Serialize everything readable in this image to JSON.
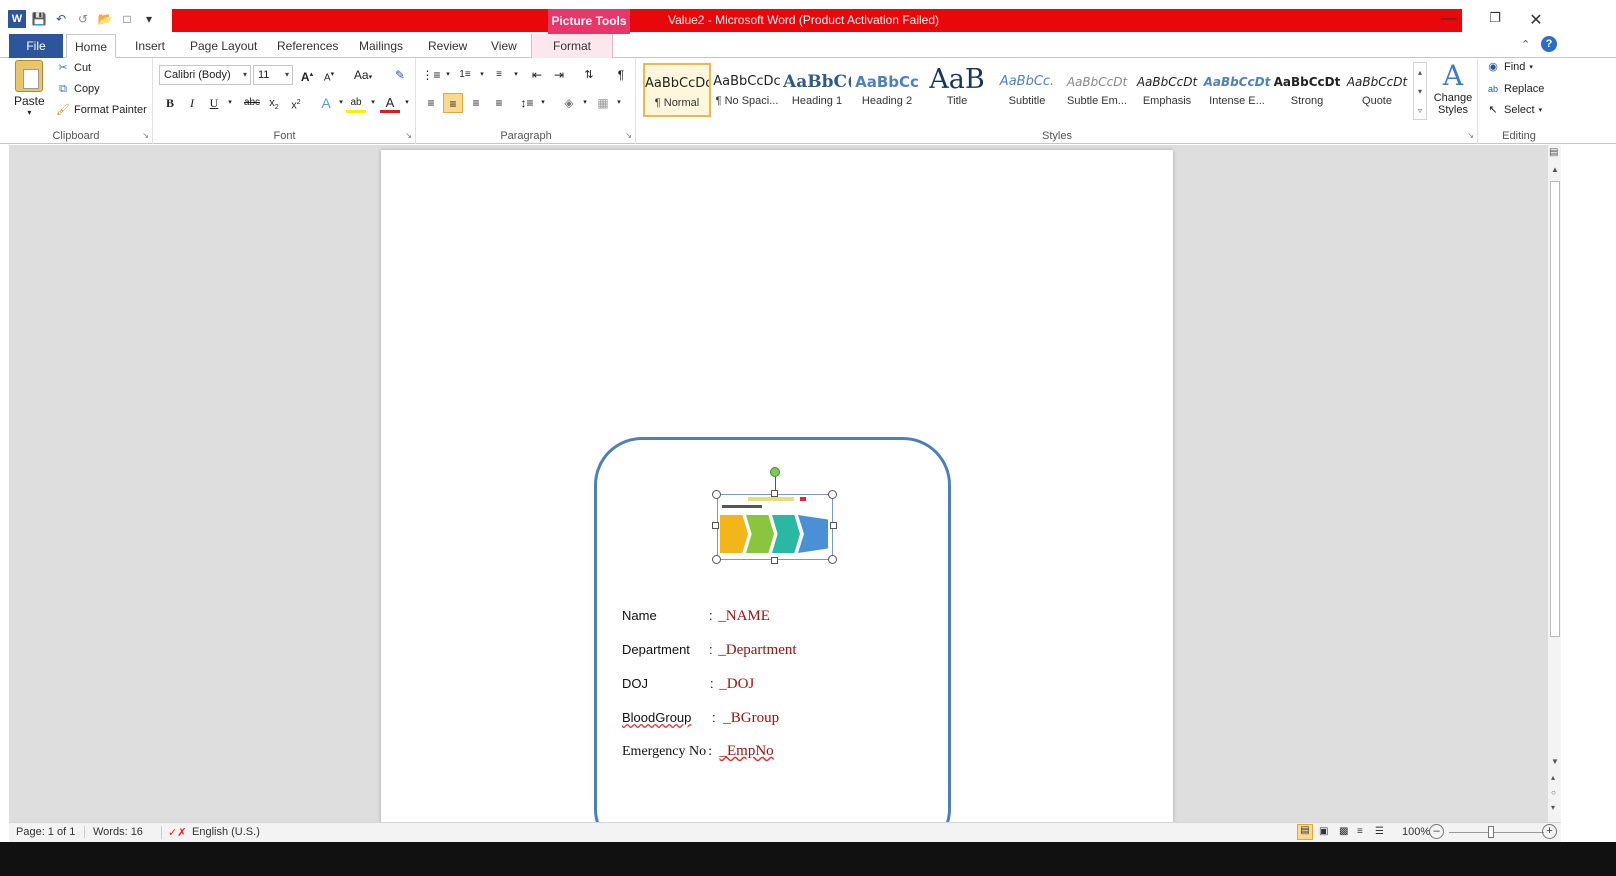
{
  "window": {
    "title": "Value2  -  Microsoft Word (Product Activation Failed)",
    "contextual_tab": "Picture Tools"
  },
  "tabs": [
    "File",
    "Home",
    "Insert",
    "Page Layout",
    "References",
    "Mailings",
    "Review",
    "View",
    "Format"
  ],
  "clipboard": {
    "paste": "Paste",
    "cut": "Cut",
    "copy": "Copy",
    "format_painter": "Format Painter",
    "label": "Clipboard"
  },
  "font": {
    "name": "Calibri (Body)",
    "size": "11",
    "label": "Font",
    "change_case": "Aa"
  },
  "paragraph": {
    "label": "Paragraph"
  },
  "styles": {
    "label": "Styles",
    "items": [
      {
        "preview": "AaBbCcDc",
        "name": "¶ Normal"
      },
      {
        "preview": "AaBbCcDc",
        "name": "¶ No Spaci..."
      },
      {
        "preview": "AaBbC(",
        "name": "Heading 1"
      },
      {
        "preview": "AaBbCc",
        "name": "Heading 2"
      },
      {
        "preview": "AaB",
        "name": "Title"
      },
      {
        "preview": "AaBbCc.",
        "name": "Subtitle"
      },
      {
        "preview": "AaBbCcDt",
        "name": "Subtle Em..."
      },
      {
        "preview": "AaBbCcDt",
        "name": "Emphasis"
      },
      {
        "preview": "AaBbCcDt",
        "name": "Intense E..."
      },
      {
        "preview": "AaBbCcDt",
        "name": "Strong"
      },
      {
        "preview": "AaBbCcDt",
        "name": "Quote"
      }
    ],
    "change_styles": "Change Styles"
  },
  "editing": {
    "find": "Find",
    "replace": "Replace",
    "select": "Select",
    "label": "Editing"
  },
  "document": {
    "fields": [
      {
        "label": "Name",
        "sep": ":",
        "value": "_NAME"
      },
      {
        "label": "Department",
        "sep": ":",
        "value": "_Department"
      },
      {
        "label": "DOJ",
        "sep": ":",
        "value": "_DOJ"
      },
      {
        "label": "BloodGroup",
        "sep": ":",
        "value": "_BGroup"
      },
      {
        "label": "Emergency No",
        "sep": ":",
        "value": "_EmpNo"
      }
    ]
  },
  "status": {
    "page": "Page: 1 of 1",
    "words": "Words: 16",
    "language": "English (U.S.)",
    "zoom": "100%"
  },
  "colors": {
    "accent": "#2b579a",
    "title_bar": "#e8070b",
    "contextual": "#e8366b",
    "card_border": "#4e7fbd",
    "field_value": "#a01010"
  }
}
